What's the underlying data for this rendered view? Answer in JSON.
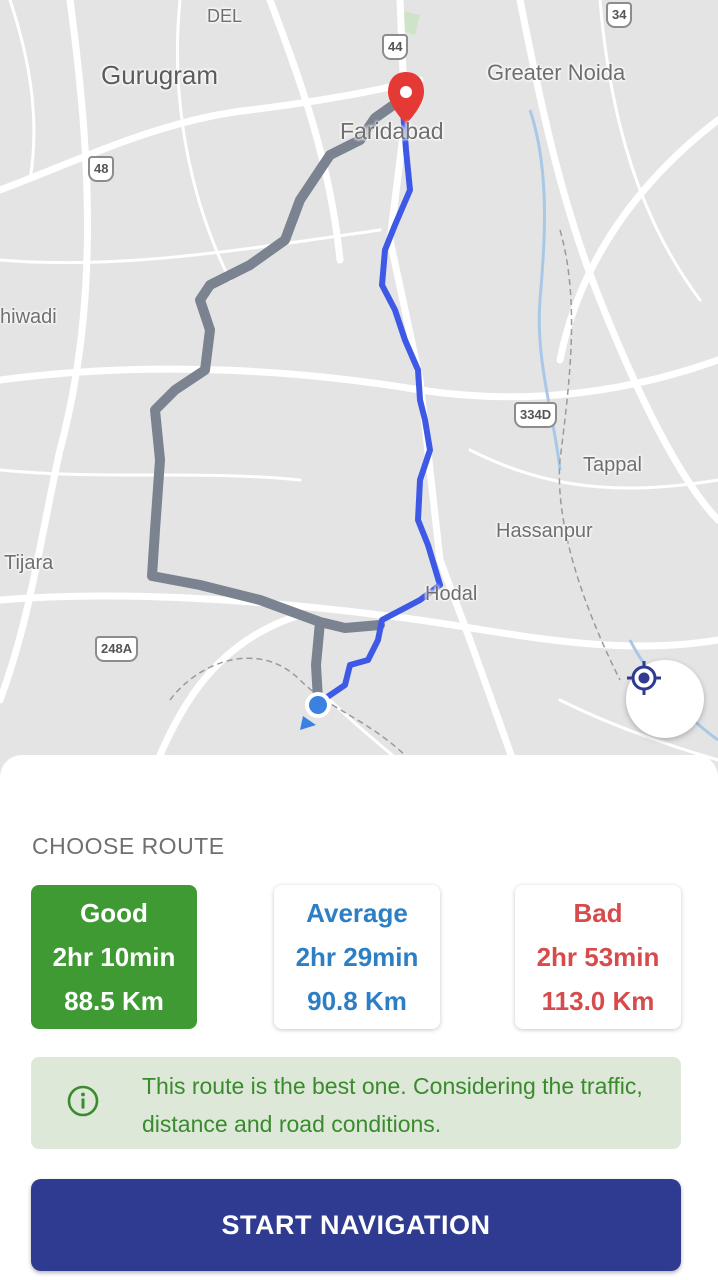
{
  "map": {
    "labels": {
      "del": "DEL",
      "gurugram": "Gurugram",
      "greater_noida": "Greater Noida",
      "faridabad": "Faridabad",
      "bhiwadi": "hiwadi",
      "tappal": "Tappal",
      "hassanpur": "Hassanpur",
      "tijara": "Tijara",
      "hodal": "Hodal"
    },
    "shields": {
      "nh34": "34",
      "nh44": "44",
      "nh48": "48",
      "nh334d": "334D",
      "nh248a": "248A"
    },
    "colors": {
      "best_route": "#3d59e6",
      "alt_route": "#7b8290",
      "destination_pin": "#e53935",
      "current_location": "#3b82e0"
    }
  },
  "route_panel": {
    "title": "CHOOSE ROUTE",
    "routes": [
      {
        "label": "Good",
        "time": "2hr 10min",
        "distance": "88.5 Km",
        "color": "#3f9a34"
      },
      {
        "label": "Average",
        "time": "2hr 29min",
        "distance": "90.8 Km",
        "color": "#2c7fc4"
      },
      {
        "label": "Bad",
        "time": "2hr 53min",
        "distance": "113.0 Km",
        "color": "#d64c4c"
      }
    ],
    "info_icon": "info-circle-icon",
    "info_text": "This route is the best one. Considering the traffic, distance and road conditions.",
    "start_button": "START NAVIGATION"
  }
}
